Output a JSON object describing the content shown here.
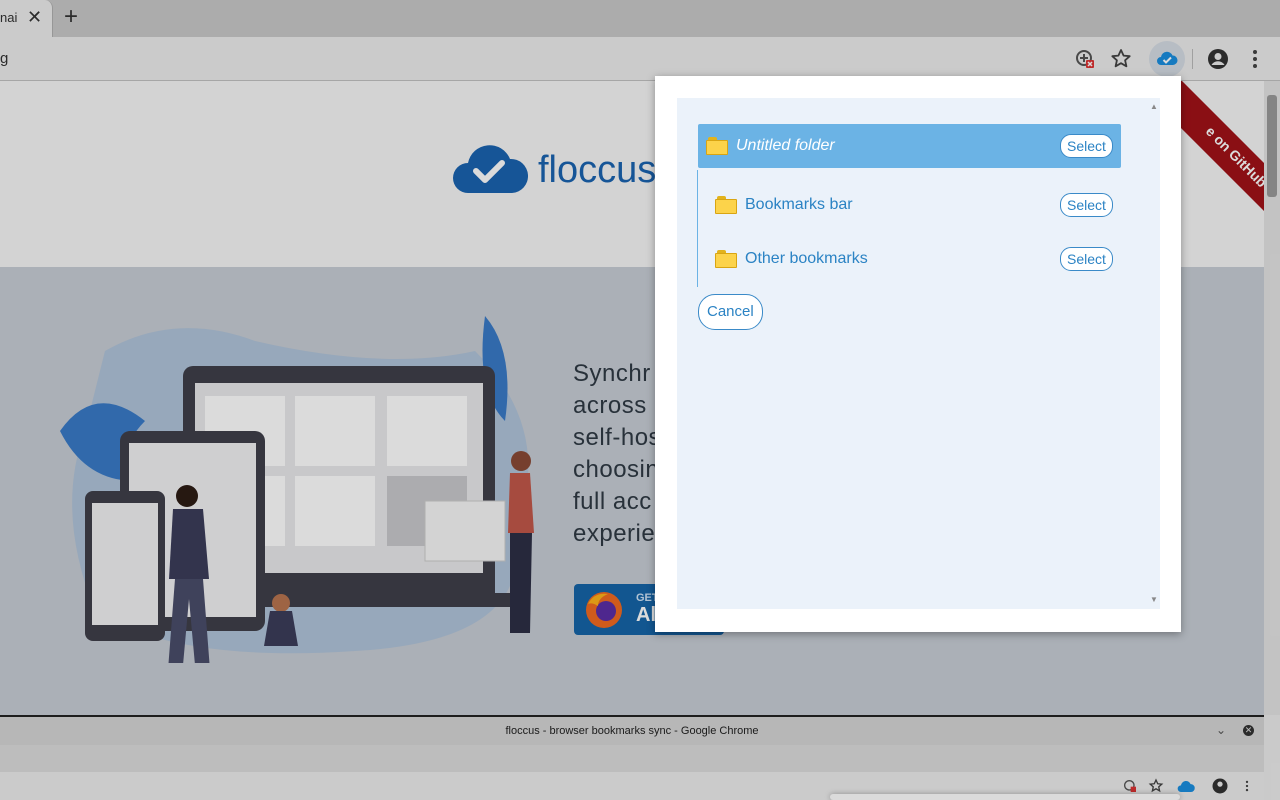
{
  "browser": {
    "tab_title": "nai",
    "tab_close": "✕",
    "new_tab": "+",
    "omnibox_text": "g"
  },
  "page": {
    "logo_text": "floccus",
    "ribbon_text": "e on GitHub",
    "tagline": [
      "Synchr",
      "across",
      "self-hos",
      "choosin",
      "full acc",
      "experie"
    ],
    "addon_badge": {
      "line1": "GET",
      "line2": "Al"
    }
  },
  "popup": {
    "items": [
      {
        "label": "Untitled folder",
        "select": "Select"
      },
      {
        "label": "Bookmarks bar",
        "select": "Select"
      },
      {
        "label": "Other bookmarks",
        "select": "Select"
      }
    ],
    "cancel": "Cancel",
    "scroll_up": "▲",
    "scroll_down": "▼"
  },
  "window2": {
    "title": "floccus - browser bookmarks sync - Google Chrome",
    "chevron": "⌄",
    "close": "✕"
  },
  "colors": {
    "accent": "#2b83c4",
    "selected_row": "#6bb3e5",
    "popup_bg": "#ebf2fa",
    "ribbon": "#a11218"
  }
}
